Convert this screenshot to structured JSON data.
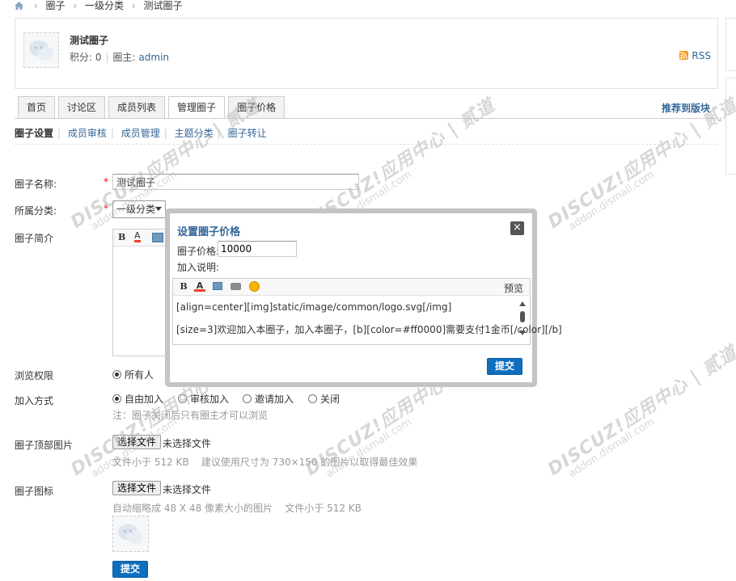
{
  "breadcrumb": {
    "items": [
      "圈子",
      "一级分类",
      "测试圈子"
    ]
  },
  "group": {
    "title": "测试圈子",
    "points_label": "积分: 0",
    "owner_label": "圈主:",
    "owner_name": "admin",
    "rss_label": "RSS"
  },
  "tabs": [
    "首页",
    "讨论区",
    "成员列表",
    "管理圈子",
    "圈子价格"
  ],
  "active_tab": "管理圈子",
  "recommend_label": "推荐到版块",
  "subnav": [
    "圈子设置",
    "成员审核",
    "成员管理",
    "主题分类",
    "圈子转让"
  ],
  "form": {
    "name_label": "圈子名称:",
    "name_value": "测试圈子",
    "category_label": "所属分类:",
    "category_value": "一级分类",
    "intro_label": "圈子简介",
    "browse_label": "浏览权限",
    "browse_option": "所有人",
    "join_label": "加入方式",
    "join_options": [
      "自由加入",
      "审核加入",
      "邀请加入",
      "关闭"
    ],
    "join_note": "注：圈子关闭后只有圈主才可以浏览",
    "banner_label": "圈子顶部图片",
    "file_button": "选择文件",
    "no_file": "未选择文件",
    "banner_note": "文件小于 512 KB    建议使用尺寸为 730×150 的图片以取得最佳效果",
    "icon_label": "圈子图标",
    "icon_note": "自动缩略成 48 X 48 像素大小的图片    文件小于 512 KB",
    "submit": "提交"
  },
  "watermark": {
    "brand": "DISCUZ!应用中心 | 贰道",
    "url": "addon.dismall.com"
  },
  "dialog": {
    "title": "设置圈子价格",
    "close": "×",
    "price_label": "圈子价格:",
    "price_value": "10000",
    "desc_label": "加入说明:",
    "preview": "预览",
    "line1": "[align=center][img]static/image/common/logo.svg[/img]",
    "line2": "[size=3]欢迎加入本圈子，加入本圈子，[b][color=#ff0000]需要支付1金币[/color][/b]",
    "submit": "提交"
  }
}
